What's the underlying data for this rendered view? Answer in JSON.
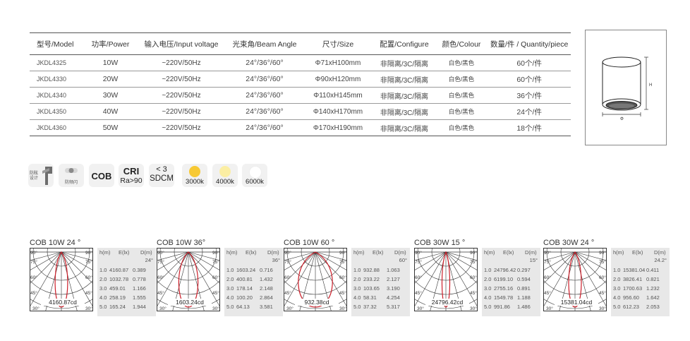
{
  "table": {
    "headers": [
      "型号/Model",
      "功率/Power",
      "输入电压/Input voltage",
      "光束角/Beam Angle",
      "尺寸/Size",
      "配置/Configure",
      "颜色/Colour",
      "数量/件 / Quantity/piece"
    ],
    "rows": [
      [
        "JKDL4325",
        "10W",
        "~220V/50Hz",
        "24°/36°/60°",
        "Φ71xH100mm",
        "非隔离/3C/隔离",
        "白色/黑色",
        "60个/件"
      ],
      [
        "JKDL4330",
        "20W",
        "~220V/50Hz",
        "24°/36°/60°",
        "Φ90xH120mm",
        "非隔离/3C/隔离",
        "白色/黑色",
        "60个/件"
      ],
      [
        "JKDL4340",
        "30W",
        "~220V/50Hz",
        "24°/36°/60°",
        "Φ110xH145mm",
        "非隔离/3C/隔离",
        "白色/黑色",
        "36个/件"
      ],
      [
        "JKDL4350",
        "40W",
        "~220V/50Hz",
        "24°/36°/60°",
        "Φ140xH170mm",
        "非隔离/3C/隔离",
        "白色/黑色",
        "24个/件"
      ],
      [
        "JKDL4360",
        "50W",
        "~220V/50Hz",
        "24°/36°/60°",
        "Φ170xH190mm",
        "非隔离/3C/隔离",
        "白色/黑色",
        "18个/件"
      ]
    ]
  },
  "drawing": {
    "height_label": "H",
    "diameter_label": "Φ"
  },
  "features": {
    "glare": "防眩\n设计",
    "flicker": "防频闪",
    "cob": "COB",
    "cri_top": "CRI",
    "cri_bottom": "Ra>90",
    "sdcm_top": "< 3",
    "sdcm_bottom": "SDCM",
    "temps": [
      {
        "label": "3000k",
        "color": "#f7c934"
      },
      {
        "label": "4000k",
        "color": "#fbeea3"
      },
      {
        "label": "6000k",
        "color": "#ffffff"
      }
    ]
  },
  "polar_common": {
    "angle_labels": [
      "90°",
      "75°",
      "60°",
      "45°",
      "30°",
      "15°"
    ],
    "table_headers": [
      "h(m)",
      "E(lx)",
      "D(m)"
    ],
    "curve_color": "#cc1f2a"
  },
  "polar_charts": [
    {
      "title": "COB 10W  24 °",
      "intensity": "4160.87cd",
      "beam": "24°",
      "beam_deg": 24,
      "rows": [
        [
          "1.0",
          "4160.87",
          "0.389"
        ],
        [
          "2.0",
          "1032.78",
          "0.778"
        ],
        [
          "3.0",
          "459.01",
          "1.166"
        ],
        [
          "4.0",
          "258.19",
          "1.555"
        ],
        [
          "5.0",
          "165.24",
          "1.944"
        ]
      ]
    },
    {
      "title": "COB 10W  36°",
      "intensity": "1603.24cd",
      "beam": "36°",
      "beam_deg": 36,
      "rows": [
        [
          "1.0",
          "1603.24",
          "0.716"
        ],
        [
          "2.0",
          "400.81",
          "1.432"
        ],
        [
          "3.0",
          "178.14",
          "2.148"
        ],
        [
          "4.0",
          "100.20",
          "2.864"
        ],
        [
          "5.0",
          "64.13",
          "3.581"
        ]
      ]
    },
    {
      "title": "COB 10W  60 °",
      "intensity": "932.38cd",
      "beam": "60°",
      "beam_deg": 60,
      "rows": [
        [
          "1.0",
          "932.88",
          "1.063"
        ],
        [
          "2.0",
          "233.22",
          "2.127"
        ],
        [
          "3.0",
          "103.65",
          "3.190"
        ],
        [
          "4.0",
          "58.31",
          "4.254"
        ],
        [
          "5.0",
          "37.32",
          "5.317"
        ]
      ]
    },
    {
      "title": "COB 30W  15 °",
      "intensity": "24796.42cd",
      "beam": "15°",
      "beam_deg": 15,
      "rows": [
        [
          "1.0",
          "24796.42",
          "0.297"
        ],
        [
          "2.0",
          "6199.10",
          "0.594"
        ],
        [
          "3.0",
          "2755.16",
          "0.891"
        ],
        [
          "4.0",
          "1549.78",
          "1.188"
        ],
        [
          "5.0",
          "991.86",
          "1.486"
        ]
      ]
    },
    {
      "title": "COB 30W  24 °",
      "intensity": "15381.04cd",
      "beam": "24.2°",
      "beam_deg": 24.2,
      "rows": [
        [
          "1.0",
          "15381.04",
          "0.411"
        ],
        [
          "2.0",
          "3826.41",
          "0.821"
        ],
        [
          "3.0",
          "1700.63",
          "1.232"
        ],
        [
          "4.0",
          "956.60",
          "1.642"
        ],
        [
          "5.0",
          "612.23",
          "2.053"
        ]
      ]
    }
  ]
}
